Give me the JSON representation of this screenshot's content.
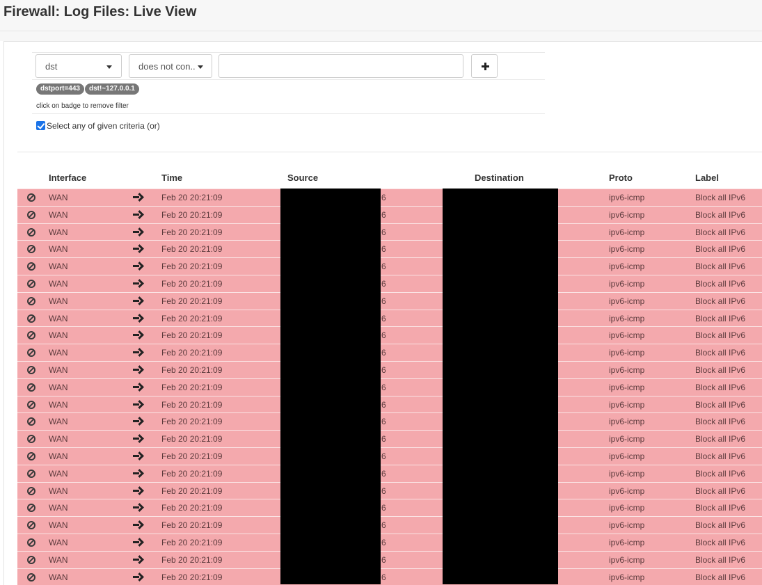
{
  "page": {
    "title": "Firewall: Log Files: Live View"
  },
  "filter": {
    "field_value": "dst",
    "operator_value": "does not con..",
    "value_input_value": "",
    "value_input_placeholder": "",
    "add_icon": "plus-icon",
    "badges": [
      {
        "label": "dstport=443"
      },
      {
        "label": "dst!~127.0.0.1"
      }
    ],
    "badge_hint": "click on badge to remove filter",
    "or_toggle_label": "Select any of given criteria (or)",
    "or_toggle_checked": true
  },
  "table": {
    "columns": {
      "interface": "Interface",
      "time": "Time",
      "source": "Source",
      "destination": "Destination",
      "proto": "Proto",
      "label": "Label"
    },
    "row_color": "#f4a9ad",
    "rows": [
      {
        "interface": "WAN",
        "time": "Feb 20 20:21:09",
        "source_tail": "6",
        "proto": "ipv6-icmp",
        "label": "Block all IPv6"
      },
      {
        "interface": "WAN",
        "time": "Feb 20 20:21:09",
        "source_tail": "6",
        "proto": "ipv6-icmp",
        "label": "Block all IPv6"
      },
      {
        "interface": "WAN",
        "time": "Feb 20 20:21:09",
        "source_tail": "6",
        "proto": "ipv6-icmp",
        "label": "Block all IPv6"
      },
      {
        "interface": "WAN",
        "time": "Feb 20 20:21:09",
        "source_tail": "6",
        "proto": "ipv6-icmp",
        "label": "Block all IPv6"
      },
      {
        "interface": "WAN",
        "time": "Feb 20 20:21:09",
        "source_tail": "6",
        "proto": "ipv6-icmp",
        "label": "Block all IPv6"
      },
      {
        "interface": "WAN",
        "time": "Feb 20 20:21:09",
        "source_tail": "6",
        "proto": "ipv6-icmp",
        "label": "Block all IPv6"
      },
      {
        "interface": "WAN",
        "time": "Feb 20 20:21:09",
        "source_tail": "6",
        "proto": "ipv6-icmp",
        "label": "Block all IPv6"
      },
      {
        "interface": "WAN",
        "time": "Feb 20 20:21:09",
        "source_tail": "6",
        "proto": "ipv6-icmp",
        "label": "Block all IPv6"
      },
      {
        "interface": "WAN",
        "time": "Feb 20 20:21:09",
        "source_tail": "6",
        "proto": "ipv6-icmp",
        "label": "Block all IPv6"
      },
      {
        "interface": "WAN",
        "time": "Feb 20 20:21:09",
        "source_tail": "6",
        "proto": "ipv6-icmp",
        "label": "Block all IPv6"
      },
      {
        "interface": "WAN",
        "time": "Feb 20 20:21:09",
        "source_tail": "6",
        "proto": "ipv6-icmp",
        "label": "Block all IPv6"
      },
      {
        "interface": "WAN",
        "time": "Feb 20 20:21:09",
        "source_tail": "6",
        "proto": "ipv6-icmp",
        "label": "Block all IPv6"
      },
      {
        "interface": "WAN",
        "time": "Feb 20 20:21:09",
        "source_tail": "6",
        "proto": "ipv6-icmp",
        "label": "Block all IPv6"
      },
      {
        "interface": "WAN",
        "time": "Feb 20 20:21:09",
        "source_tail": "6",
        "proto": "ipv6-icmp",
        "label": "Block all IPv6"
      },
      {
        "interface": "WAN",
        "time": "Feb 20 20:21:09",
        "source_tail": "6",
        "proto": "ipv6-icmp",
        "label": "Block all IPv6"
      },
      {
        "interface": "WAN",
        "time": "Feb 20 20:21:09",
        "source_tail": "6",
        "proto": "ipv6-icmp",
        "label": "Block all IPv6"
      },
      {
        "interface": "WAN",
        "time": "Feb 20 20:21:09",
        "source_tail": "6",
        "proto": "ipv6-icmp",
        "label": "Block all IPv6"
      },
      {
        "interface": "WAN",
        "time": "Feb 20 20:21:09",
        "source_tail": "6",
        "proto": "ipv6-icmp",
        "label": "Block all IPv6"
      },
      {
        "interface": "WAN",
        "time": "Feb 20 20:21:09",
        "source_tail": "6",
        "proto": "ipv6-icmp",
        "label": "Block all IPv6"
      },
      {
        "interface": "WAN",
        "time": "Feb 20 20:21:09",
        "source_tail": "6",
        "proto": "ipv6-icmp",
        "label": "Block all IPv6"
      },
      {
        "interface": "WAN",
        "time": "Feb 20 20:21:09",
        "source_tail": "6",
        "proto": "ipv6-icmp",
        "label": "Block all IPv6"
      },
      {
        "interface": "WAN",
        "time": "Feb 20 20:21:09",
        "source_tail": "6",
        "proto": "ipv6-icmp",
        "label": "Block all IPv6"
      },
      {
        "interface": "WAN",
        "time": "Feb 20 20:21:09",
        "source_tail": "6",
        "proto": "ipv6-icmp",
        "label": "Block all IPv6"
      }
    ],
    "row_icons": {
      "action": "block-icon",
      "direction": "arrow-right-icon"
    }
  }
}
